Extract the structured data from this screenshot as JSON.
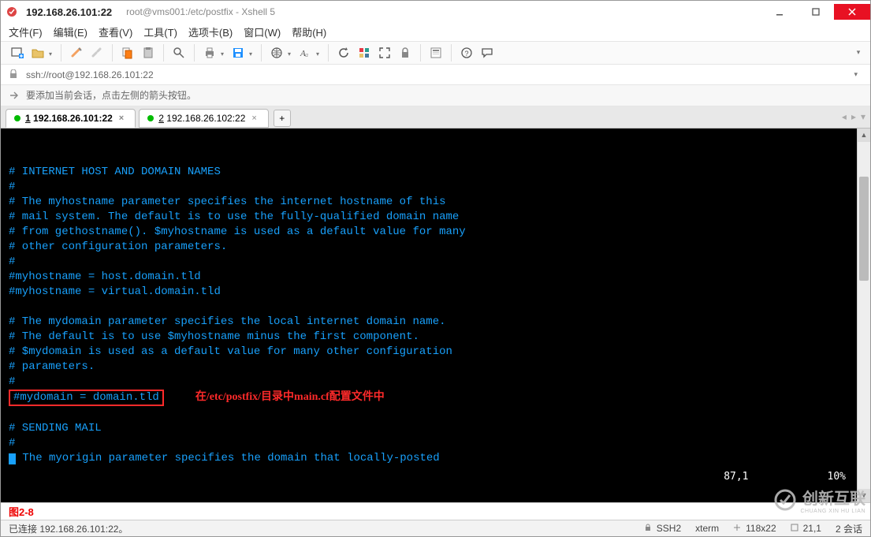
{
  "titlebar": {
    "main": "192.168.26.101:22",
    "sub": "root@vms001:/etc/postfix - Xshell 5"
  },
  "menu": {
    "file": "文件(F)",
    "edit": "编辑(E)",
    "view": "查看(V)",
    "tools": "工具(T)",
    "tabs": "选项卡(B)",
    "window": "窗口(W)",
    "help": "帮助(H)"
  },
  "toolbar_icons": {
    "new": "new-session-icon",
    "open": "open-icon",
    "reconnect": "reconnect-icon",
    "disconnect": "disconnect-icon",
    "copy": "copy-icon",
    "paste": "paste-icon",
    "find": "find-icon",
    "print": "print-icon",
    "save": "save-icon",
    "globe": "globe-icon",
    "font": "font-icon",
    "refresh": "refresh-icon",
    "color": "color-icon",
    "fullscreen": "fullscreen-icon",
    "lock": "lock-icon",
    "props": "props-icon",
    "help": "help-icon",
    "chat": "chat-icon"
  },
  "addressbar": {
    "url": "ssh://root@192.168.26.101:22"
  },
  "infobar": {
    "message": "要添加当前会话，点击左侧的箭头按钮。"
  },
  "tabs": [
    {
      "index_label": "1",
      "host": "192.168.26.101:22",
      "active": true
    },
    {
      "index_label": "2",
      "host": "192.168.26.102:22",
      "active": false
    }
  ],
  "terminal": {
    "lines": [
      "",
      "# INTERNET HOST AND DOMAIN NAMES",
      "#",
      "# The myhostname parameter specifies the internet hostname of this",
      "# mail system. The default is to use the fully-qualified domain name",
      "# from gethostname(). $myhostname is used as a default value for many",
      "# other configuration parameters.",
      "#",
      "#myhostname = host.domain.tld",
      "#myhostname = virtual.domain.tld",
      "",
      "# The mydomain parameter specifies the local internet domain name.",
      "# The default is to use $myhostname minus the first component.",
      "# $mydomain is used as a default value for many other configuration",
      "# parameters.",
      "#"
    ],
    "highlighted_line": "#mydomain = domain.tld",
    "annotation": "在/etc/postfix/目录中main.cf配置文件中",
    "after_lines": [
      "",
      "# SENDING MAIL",
      "#"
    ],
    "last_prefix": "#",
    "last_line_rest": " The myorigin parameter specifies the domain that locally-posted",
    "cursor_pos": "87,1",
    "percent": "10%"
  },
  "bottom_label": "图2-8",
  "statusbar": {
    "connected": "已连接 192.168.26.101:22。",
    "proto": "SSH2",
    "termtype": "xterm",
    "size": "118x22",
    "pos": "21,1",
    "sessions": "2 会话"
  },
  "watermark": {
    "main": "创新互联",
    "sub": "CHUANG XIN HU LIAN"
  }
}
